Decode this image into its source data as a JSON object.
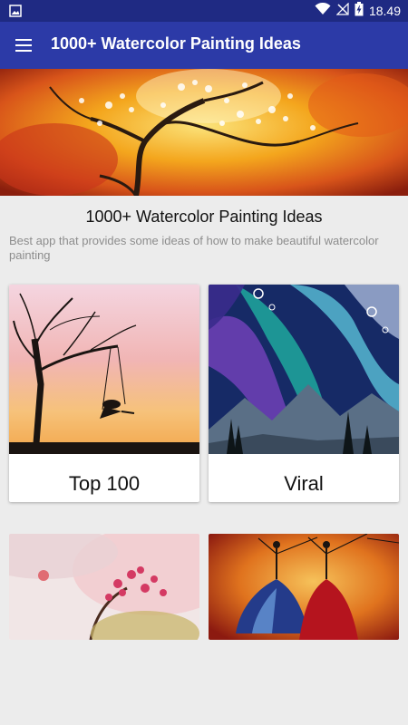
{
  "status_bar": {
    "time": "18.49",
    "icons": [
      "image-icon",
      "wifi-icon",
      "signal-off-icon",
      "battery-charging-icon"
    ]
  },
  "app_bar": {
    "title": "1000+ Watercolor Painting Ideas",
    "menu_icon": "menu-icon"
  },
  "intro": {
    "title": "1000+ Watercolor Painting Ideas",
    "description": "Best app that provides some ideas of how to make beautiful watercolor painting"
  },
  "categories": [
    {
      "label": "Top 100"
    },
    {
      "label": "Viral"
    },
    {
      "label": ""
    },
    {
      "label": ""
    }
  ],
  "colors": {
    "status_bar": "#1f2a83",
    "app_bar": "#2c3aa7",
    "background": "#ececec"
  }
}
